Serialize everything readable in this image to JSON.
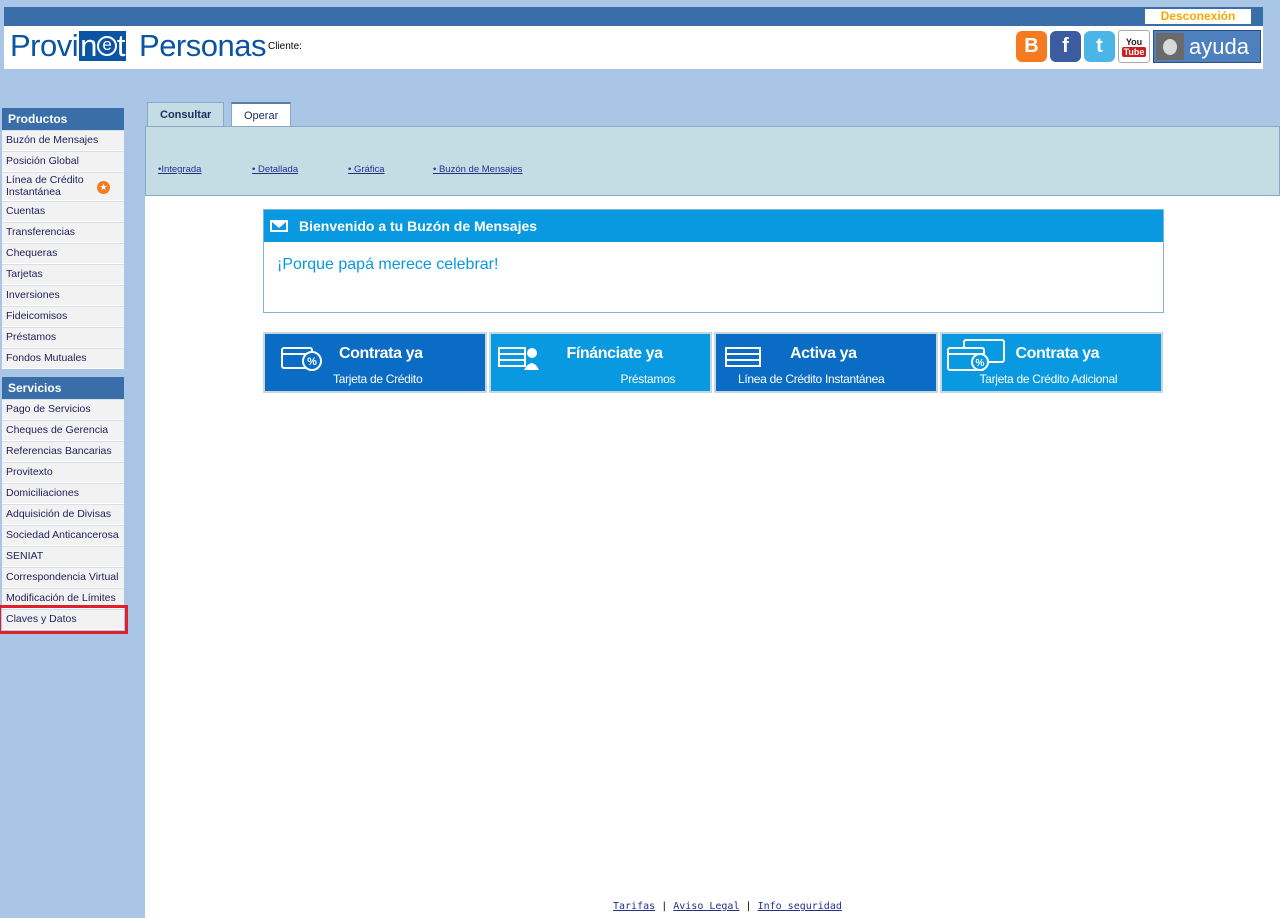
{
  "header": {
    "logout_label": "Desconexión",
    "logo_part1": "Provi",
    "logo_box_letter_n": "n",
    "logo_box_letter_e": "e",
    "logo_box_letter_t": "t",
    "logo_part2": "Personas",
    "client_label": "Cliente:",
    "social": [
      {
        "name": "blogger-icon",
        "glyph": "B"
      },
      {
        "name": "facebook-icon",
        "glyph": "f"
      },
      {
        "name": "twitter-icon",
        "glyph": "t"
      }
    ],
    "youtube": {
      "you": "You",
      "tube": "Tube"
    },
    "help_label": "ayuda"
  },
  "sidebar": {
    "productos_title": "Productos",
    "productos": [
      "Buzón de Mensajes",
      "Posición Global",
      "Línea de Crédito Instantánea",
      "Cuentas",
      "Transferencias",
      "Chequeras",
      "Tarjetas",
      "Inversiones",
      "Fideicomisos",
      "Préstamos",
      "Fondos Mutuales"
    ],
    "servicios_title": "Servicios",
    "servicios": [
      "Pago de Servicios",
      "Cheques de Gerencia",
      "Referencias Bancarias",
      "Provitexto",
      "Domiciliaciones",
      "Adquisición de Divisas",
      "Sociedad Anticancerosa",
      "SENIAT",
      "Correspondencia Virtual",
      "Modificación de Límites",
      "Claves y Datos"
    ]
  },
  "tabs": {
    "consultar": "Consultar",
    "operar": "Operar",
    "sublinks": [
      "•Integrada",
      "• Detallada",
      "• Gráfica",
      "• Buzón de Mensajes"
    ]
  },
  "message": {
    "title": "Bienvenido a tu Buzón de Mensajes",
    "text": "¡Porque papá merece celebrar!"
  },
  "banners": [
    {
      "title": "Contrata ya",
      "subtitle": "Tarjeta de Crédito"
    },
    {
      "title": "Fínánciate ya",
      "subtitle": "Préstamos"
    },
    {
      "title": "Activa ya",
      "subtitle": "Línea de Crédito Instantánea"
    },
    {
      "title": "Contrata ya",
      "subtitle": "Tarjeta de Crédito Adicional"
    }
  ],
  "footer": {
    "tarifas": "Tarifas",
    "aviso": "Aviso Legal",
    "info": "Info seguridad",
    "sep": "|"
  },
  "colors": {
    "brand_blue": "#0b54a4",
    "accent_orange": "#f5a800",
    "banner_blue": "#0899e0"
  }
}
